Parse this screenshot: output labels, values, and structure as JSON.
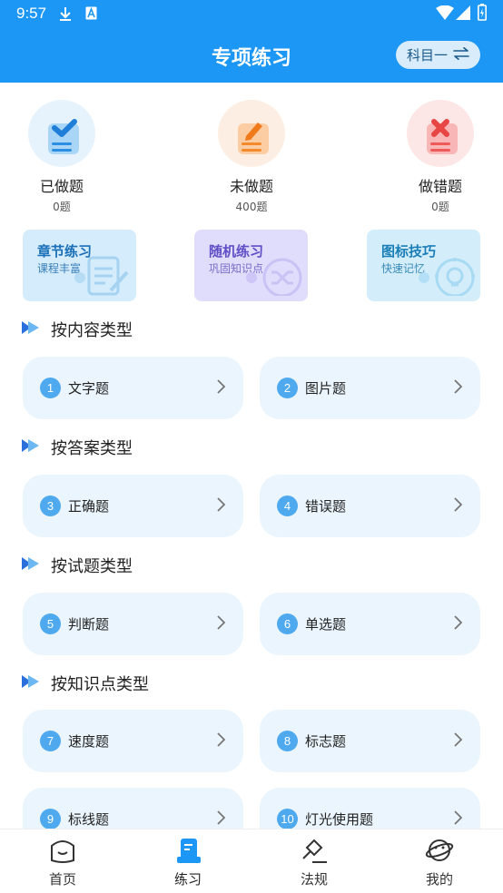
{
  "status": {
    "time": "9:57"
  },
  "header": {
    "title": "专项练习",
    "subject": "科目一"
  },
  "stats": [
    {
      "label": "已做题",
      "count": "0题"
    },
    {
      "label": "未做题",
      "count": "400题"
    },
    {
      "label": "做错题",
      "count": "0题"
    }
  ],
  "features": [
    {
      "title": "章节练习",
      "sub": "课程丰富"
    },
    {
      "title": "随机练习",
      "sub": "巩固知识点"
    },
    {
      "title": "图标技巧",
      "sub": "快速记忆"
    }
  ],
  "sections": [
    {
      "title": "按内容类型",
      "items": [
        {
          "num": "1",
          "label": "文字题"
        },
        {
          "num": "2",
          "label": "图片题"
        }
      ]
    },
    {
      "title": "按答案类型",
      "items": [
        {
          "num": "3",
          "label": "正确题"
        },
        {
          "num": "4",
          "label": "错误题"
        }
      ]
    },
    {
      "title": "按试题类型",
      "items": [
        {
          "num": "5",
          "label": "判断题"
        },
        {
          "num": "6",
          "label": "单选题"
        }
      ]
    },
    {
      "title": "按知识点类型",
      "items": [
        {
          "num": "7",
          "label": "速度题"
        },
        {
          "num": "8",
          "label": "标志题"
        },
        {
          "num": "9",
          "label": "标线题"
        },
        {
          "num": "10",
          "label": "灯光使用题"
        }
      ]
    }
  ],
  "nav": [
    {
      "label": "首页"
    },
    {
      "label": "练习"
    },
    {
      "label": "法规"
    },
    {
      "label": "我的"
    }
  ],
  "colors": {
    "primary": "#1c97f5",
    "item_bg": "#eaf5fd",
    "num_badge": "#4fa9ee"
  }
}
